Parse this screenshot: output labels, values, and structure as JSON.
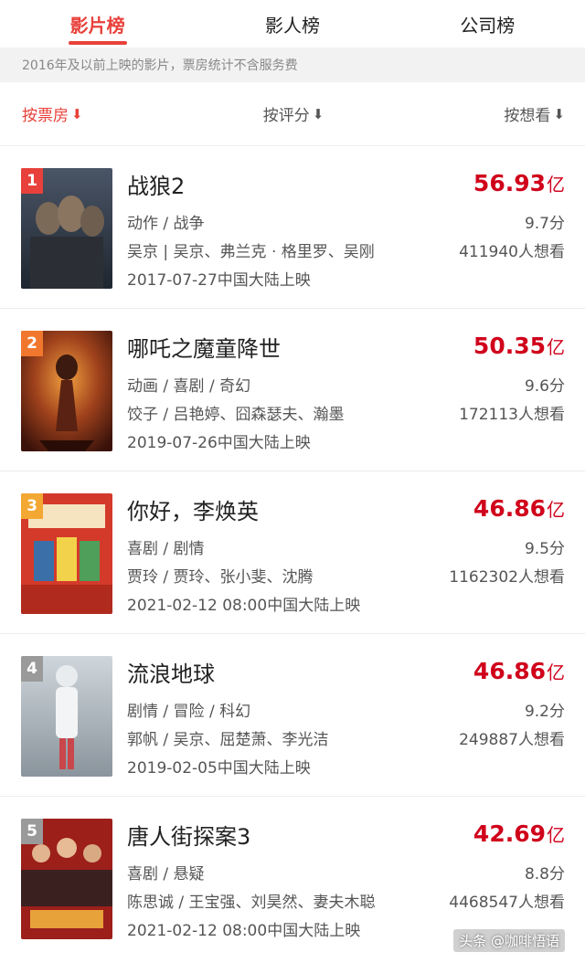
{
  "tabs": [
    {
      "label": "影片榜",
      "active": true
    },
    {
      "label": "影人榜",
      "active": false
    },
    {
      "label": "公司榜",
      "active": false
    }
  ],
  "notice": "2016年及以前上映的影片，票房统计不含服务费",
  "sort": [
    {
      "label": "按票房",
      "arrow": "⬇",
      "active": true
    },
    {
      "label": "按评分",
      "arrow": "⬇",
      "active": false
    },
    {
      "label": "按想看",
      "arrow": "⬇",
      "active": false
    }
  ],
  "movies": [
    {
      "rank": "1",
      "title": "战狼2",
      "genre": "动作 / 战争",
      "cast": "吴京 | 吴京、弗兰克 · 格里罗、吴刚",
      "date": "2017-07-27中国大陆上映",
      "box": "56.93",
      "unit": "亿",
      "score": "9.7分",
      "want": "411940人想看"
    },
    {
      "rank": "2",
      "title": "哪吒之魔童降世",
      "genre": "动画 / 喜剧 / 奇幻",
      "cast": "饺子 / 吕艳婷、囧森瑟夫、瀚墨",
      "date": "2019-07-26中国大陆上映",
      "box": "50.35",
      "unit": "亿",
      "score": "9.6分",
      "want": "172113人想看"
    },
    {
      "rank": "3",
      "title": "你好，李焕英",
      "genre": "喜剧 / 剧情",
      "cast": "贾玲 / 贾玲、张小斐、沈腾",
      "date": "2021-02-12 08:00中国大陆上映",
      "box": "46.86",
      "unit": "亿",
      "score": "9.5分",
      "want": "1162302人想看"
    },
    {
      "rank": "4",
      "title": "流浪地球",
      "genre": "剧情 / 冒险 / 科幻",
      "cast": "郭帆 / 吴京、屈楚萧、李光洁",
      "date": "2019-02-05中国大陆上映",
      "box": "46.86",
      "unit": "亿",
      "score": "9.2分",
      "want": "249887人想看"
    },
    {
      "rank": "5",
      "title": "唐人街探案3",
      "genre": "喜剧 / 悬疑",
      "cast": "陈思诚 / 王宝强、刘昊然、妻夫木聪",
      "date": "2021-02-12 08:00中国大陆上映",
      "box": "42.69",
      "unit": "亿",
      "score": "8.8分",
      "want": "4468547人想看"
    }
  ],
  "colors": {
    "accent": "#e8413b",
    "box_office": "#d0021b",
    "rank_badges": [
      "#e8413b",
      "#f0772d",
      "#f3a833",
      "#9a9a9a",
      "#9a9a9a"
    ]
  },
  "watermark": "头条 @咖啡悟语"
}
